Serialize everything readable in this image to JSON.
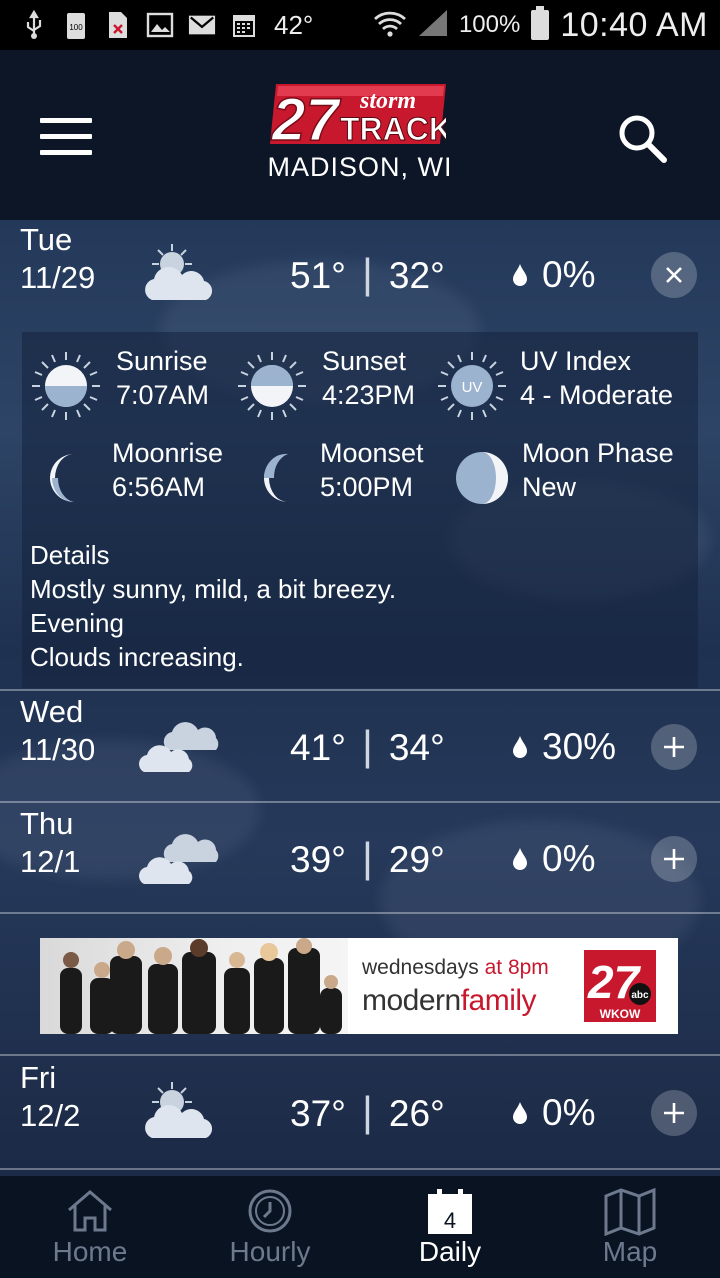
{
  "status_bar": {
    "temperature": "42°",
    "battery_percent": "100%",
    "time": "10:40 AM"
  },
  "header": {
    "logo_number": "27",
    "logo_word1": "storm",
    "logo_word2": "TRACK",
    "location": "MADISON, WI",
    "menu_icon": "hamburger-icon",
    "search_icon": "search-icon"
  },
  "days": [
    {
      "day": "Tue",
      "date": "11/29",
      "high": "51°",
      "low": "32°",
      "precip": "0%",
      "icon": "partly-sunny-icon",
      "expanded": true
    },
    {
      "day": "Wed",
      "date": "11/30",
      "high": "41°",
      "low": "34°",
      "precip": "30%",
      "icon": "cloudy-icon",
      "expanded": false
    },
    {
      "day": "Thu",
      "date": "12/1",
      "high": "39°",
      "low": "29°",
      "precip": "0%",
      "icon": "cloudy-icon",
      "expanded": false
    },
    {
      "day": "Fri",
      "date": "12/2",
      "high": "37°",
      "low": "26°",
      "precip": "0%",
      "icon": "partly-sunny-icon",
      "expanded": false
    }
  ],
  "temp_separator": "|",
  "detail": {
    "sunrise_label": "Sunrise",
    "sunrise_value": "7:07AM",
    "sunset_label": "Sunset",
    "sunset_value": "4:23PM",
    "uv_label": "UV Index",
    "uv_value": "4 - Moderate",
    "uv_icon_text": "UV",
    "moonrise_label": "Moonrise",
    "moonrise_value": "6:56AM",
    "moonset_label": "Moonset",
    "moonset_value": "5:00PM",
    "moonphase_label": "Moon Phase",
    "moonphase_value": "New",
    "details_heading": "Details",
    "details_day": "Mostly sunny, mild, a bit breezy.",
    "evening_heading": "Evening",
    "details_evening": "Clouds increasing."
  },
  "ad": {
    "line1_a": "wednesdays",
    "line1_b": "at 8pm",
    "line2_a": "modern",
    "line2_b": "family",
    "station_number": "27",
    "station_call": "WKOW",
    "network": "abc"
  },
  "nav": [
    {
      "label": "Home",
      "icon": "home-icon",
      "active": false
    },
    {
      "label": "Hourly",
      "icon": "clock-icon",
      "active": false
    },
    {
      "label": "Daily",
      "icon": "calendar-icon",
      "active": true,
      "badge": "4"
    },
    {
      "label": "Map",
      "icon": "map-icon",
      "active": false
    }
  ],
  "colors": {
    "accent_red": "#c7182e",
    "appbar": "#0d1626",
    "inactive_nav": "#6d7a8e"
  }
}
